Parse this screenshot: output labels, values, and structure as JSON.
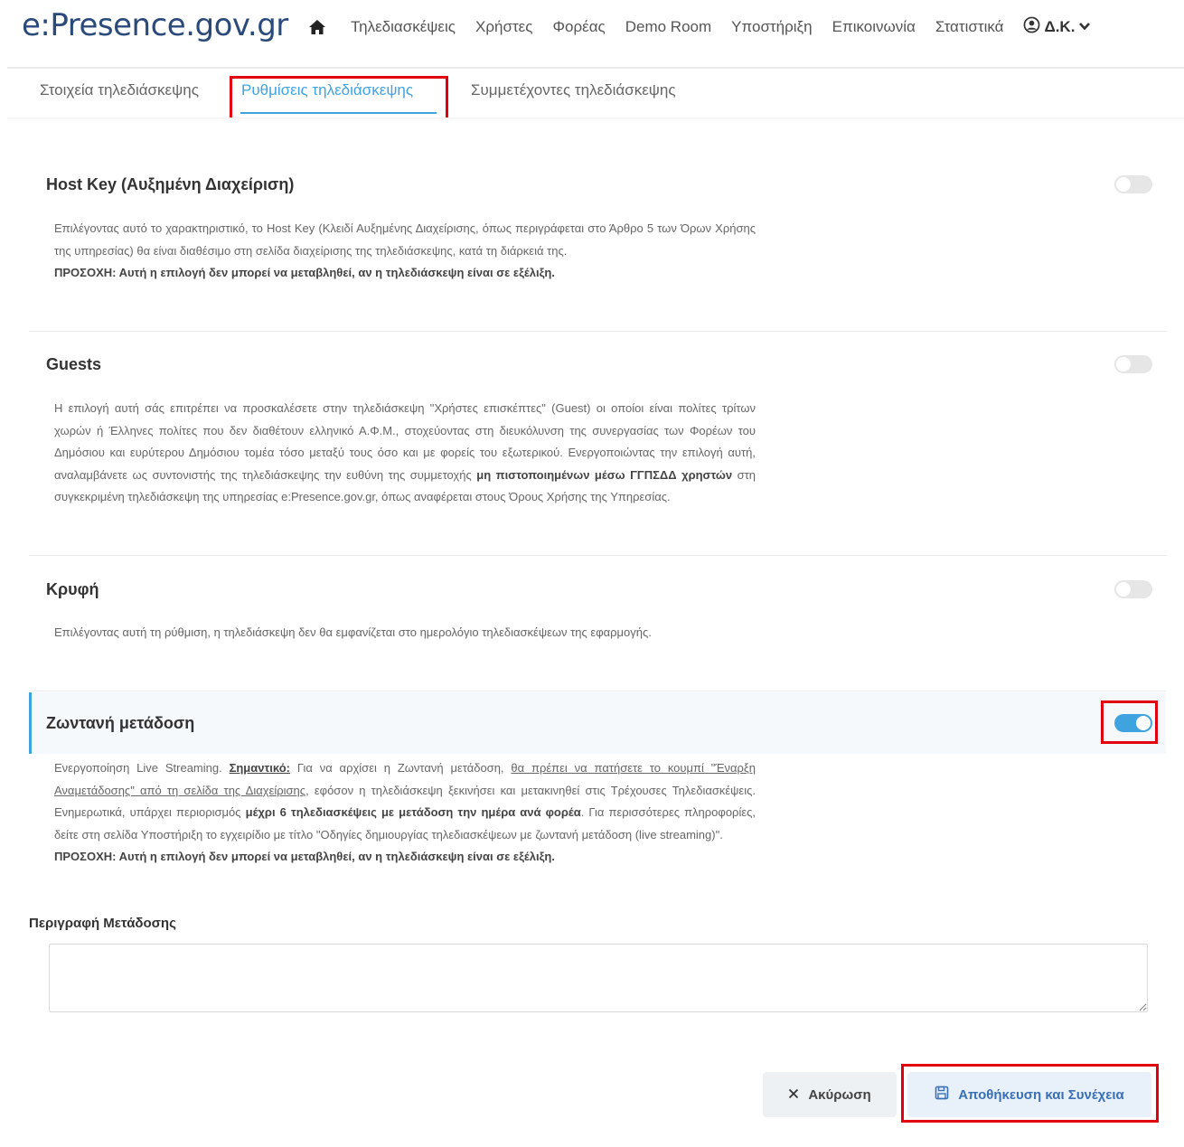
{
  "header": {
    "logo": "e:Presence.gov.gr",
    "nav": [
      "Τηλεδιασκέψεις",
      "Χρήστες",
      "Φορέας",
      "Demo Room",
      "Υποστήριξη",
      "Επικοινωνία",
      "Στατιστικά"
    ],
    "user": "Δ.Κ."
  },
  "tabs": [
    {
      "label": "Στοιχεία τηλεδιάσκεψης"
    },
    {
      "label": "Ρυθμίσεις τηλεδιάσκεψης",
      "active": true
    },
    {
      "label": "Συμμετέχοντες τηλεδιάσκεψης"
    }
  ],
  "sections": {
    "hostkey": {
      "title": "Host Key (Αυξημένη Διαχείριση)",
      "text": "Επιλέγοντας αυτό το χαρακτηριστικό, το Host Key (Κλειδί Αυξημένης Διαχείρισης, όπως περιγράφεται στο Άρθρο 5 των Όρων Χρήσης της υπηρεσίας) θα είναι διαθέσιμο στη σελίδα διαχείρισης της τηλεδιάσκεψης, κατά τη διάρκειά της.",
      "warning": "ΠΡΟΣΟΧΗ: Αυτή η επιλογή δεν μπορεί να μεταβληθεί, αν η τηλεδιάσκεψη είναι σε εξέλιξη.",
      "enabled": false
    },
    "guests": {
      "title": "Guests",
      "text_1": "Η επιλογή αυτή σάς επιτρέπει να προσκαλέσετε στην τηλεδιάσκεψη \"Χρήστες επισκέπτες\" (Guest) οι οποίοι είναι πολίτες τρίτων χωρών ή Έλληνες πολίτες που δεν διαθέτουν ελληνικό Α.Φ.Μ., στοχεύοντας στη διευκόλυνση της συνεργασίας των Φορέων του Δημόσιου και ευρύτερου Δημόσιου τομέα τόσο μεταξύ τους όσο και με φορείς του εξωτερικού. Ενεργοποιώντας την επιλογή αυτή, αναλαμβάνετε ως συντονιστής της τηλεδιάσκεψης την ευθύνη της συμμετοχής ",
      "text_bold": "μη πιστοποιημένων μέσω ΓΓΠΣΔΔ χρηστών",
      "text_2": " στη συγκεκριμένη τηλεδιάσκεψη της υπηρεσίας e:Presence.gov.gr, όπως αναφέρεται στους Όρους Χρήσης της Υπηρεσίας.",
      "enabled": false
    },
    "hidden": {
      "title": "Κρυφή",
      "text": "Επιλέγοντας αυτή τη ρύθμιση, η τηλεδιάσκεψη δεν θα εμφανίζεται στο ημερολόγιο τηλεδιασκέψεων της εφαρμογής.",
      "enabled": false
    },
    "live": {
      "title": "Ζωντανή μετάδοση",
      "text_1": "Ενεργοποίηση Live Streaming. ",
      "text_important": "Σημαντικό:",
      "text_2": " Για να αρχίσει η Ζωντανή μετάδοση, ",
      "text_link": "θα πρέπει να πατήσετε το κουμπί \"Έναρξη Αναμετάδοσης\" από τη σελίδα της Διαχείρισης",
      "text_3": ", εφόσον η τηλεδιάσκεψη ξεκινήσει και μετακινηθεί στις Τρέχουσες Τηλεδιασκέψεις. Ενημερωτικά, υπάρχει περιορισμός ",
      "text_bold": "μέχρι 6 τηλεδιασκέψεις με μετάδοση την ημέρα ανά φορέα",
      "text_4": ". Για περισσότερες πληροφορίες, δείτε στη σελίδα Υποστήριξη το εγχειρίδιο με τίτλο \"Οδηγίες δημιουργίας τηλεδιασκέψεων με ζωντανή μετάδοση (live streaming)\".",
      "warning": "ΠΡΟΣΟΧΗ: Αυτή η επιλογή δεν μπορεί να μεταβληθεί, αν η τηλεδιάσκεψη είναι σε εξέλιξη.",
      "enabled": true
    }
  },
  "stream_description": {
    "label": "Περιγραφή Μετάδοσης",
    "value": ""
  },
  "buttons": {
    "cancel": "Ακύρωση",
    "save": "Αποθήκευση και Συνέχεια"
  },
  "colors": {
    "accent": "#3fa3e0",
    "highlight": "#e1000f",
    "logo": "#2a4a7a"
  }
}
